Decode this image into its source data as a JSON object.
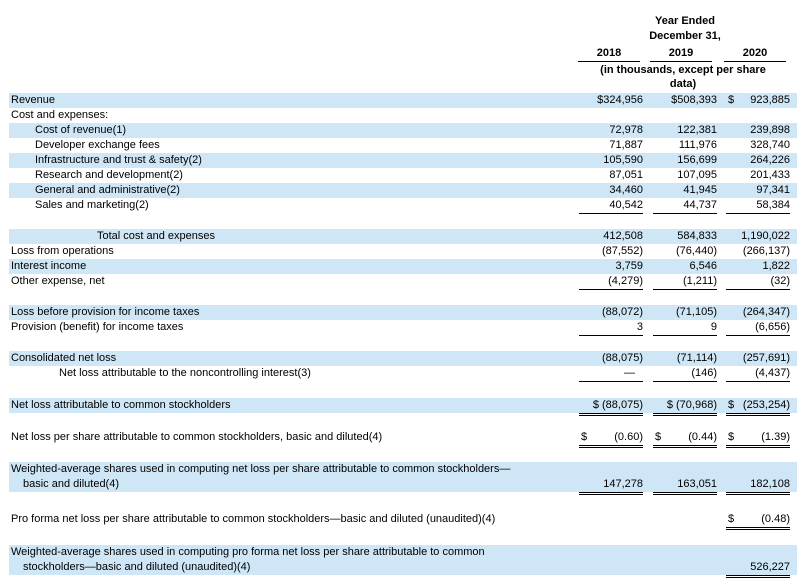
{
  "header": {
    "year_ended": "Year Ended",
    "december": "December 31,",
    "years": [
      "2018",
      "2019",
      "2020"
    ],
    "units_line1": "(in thousands, except per share",
    "units_line2": "data)"
  },
  "rows": {
    "revenue": {
      "label": "Revenue",
      "v2018": "$324,956",
      "v2019": "$508,393",
      "v2020_sym": "$",
      "v2020": "923,885"
    },
    "cost_header": {
      "label": "Cost and expenses:"
    },
    "cost_of_revenue": {
      "label": "Cost of revenue(1)",
      "v2018": "72,978",
      "v2019": "122,381",
      "v2020": "239,898"
    },
    "developer_exchange": {
      "label": "Developer exchange fees",
      "v2018": "71,887",
      "v2019": "111,976",
      "v2020": "328,740"
    },
    "infrastructure": {
      "label": "Infrastructure and trust & safety(2)",
      "v2018": "105,590",
      "v2019": "156,699",
      "v2020": "264,226"
    },
    "research": {
      "label": "Research and development(2)",
      "v2018": "87,051",
      "v2019": "107,095",
      "v2020": "201,433"
    },
    "general_admin": {
      "label": "General and administrative(2)",
      "v2018": "34,460",
      "v2019": "41,945",
      "v2020": "97,341"
    },
    "sales_marketing": {
      "label": "Sales and marketing(2)",
      "v2018": "40,542",
      "v2019": "44,737",
      "v2020": "58,384"
    },
    "total_cost": {
      "label": "Total cost and expenses",
      "v2018": "412,508",
      "v2019": "584,833",
      "v2020": "1,190,022"
    },
    "loss_ops": {
      "label": "Loss from operations",
      "v2018": "(87,552)",
      "v2019": "(76,440)",
      "v2020": "(266,137)"
    },
    "interest_income": {
      "label": "Interest income",
      "v2018": "3,759",
      "v2019": "6,546",
      "v2020": "1,822"
    },
    "other_expense": {
      "label": "Other expense, net",
      "v2018": "(4,279)",
      "v2019": "(1,211)",
      "v2020": "(32)"
    },
    "loss_before_tax": {
      "label": "Loss before provision for income taxes",
      "v2018": "(88,072)",
      "v2019": "(71,105)",
      "v2020": "(264,347)"
    },
    "provision": {
      "label": "Provision (benefit) for income taxes",
      "v2018": "3",
      "v2019": "9",
      "v2020": "(6,656)"
    },
    "consolidated_loss": {
      "label": "Consolidated net loss",
      "v2018": "(88,075)",
      "v2019": "(71,114)",
      "v2020": "(257,691)"
    },
    "noncontrolling": {
      "label": "Net loss attributable to the noncontrolling interest(3)",
      "v2018": "—",
      "v2019": "(146)",
      "v2020": "(4,437)"
    },
    "net_loss_common": {
      "label": "Net loss attributable to common stockholders",
      "v2018": "$ (88,075)",
      "v2019": "$ (70,968)",
      "v2020_sym": "$",
      "v2020": "(253,254)"
    },
    "eps": {
      "label": "Net loss per share attributable to common stockholders, basic and diluted(4)",
      "sym": "$",
      "v2018": "(0.60)",
      "v2019": "(0.44)",
      "v2020": "(1.39)"
    },
    "weighted_shares": {
      "label": "Weighted-average shares used in computing net loss per share attributable to common stockholders—",
      "label2": "basic and diluted(4)",
      "v2018": "147,278",
      "v2019": "163,051",
      "v2020": "182,108"
    },
    "pro_forma_eps": {
      "label": "Pro forma net loss per share attributable to common stockholders—basic and diluted (unaudited)(4)",
      "sym": "$",
      "v2020": "(0.48)"
    },
    "pro_forma_shares": {
      "label": "Weighted-average shares used in computing pro forma net loss per share attributable to common",
      "label2": "stockholders—basic and diluted (unaudited)(4)",
      "v2020": "526,227"
    }
  }
}
